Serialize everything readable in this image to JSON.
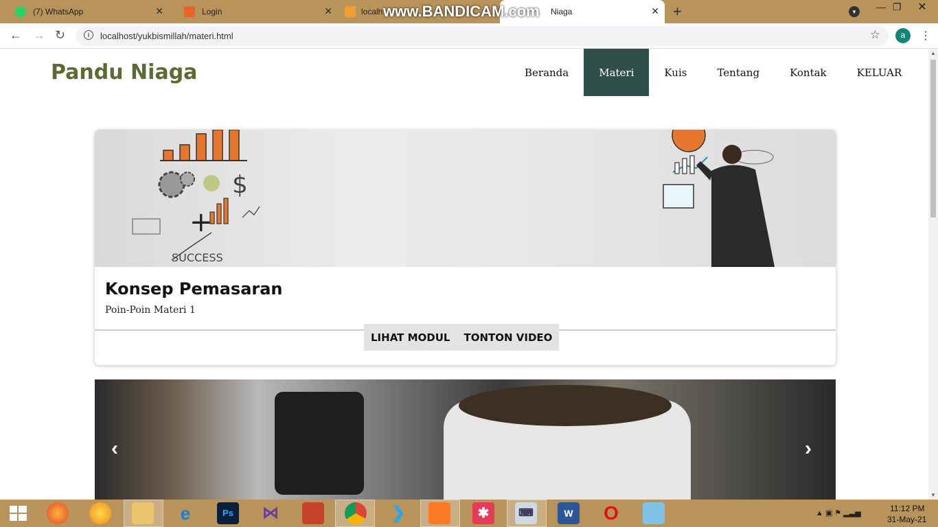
{
  "browser": {
    "tabs": [
      {
        "label": "(7) WhatsApp",
        "icon": "whatsapp-icon"
      },
      {
        "label": "Login",
        "icon": "xampp-icon"
      },
      {
        "label": "localh",
        "icon": "pma-icon"
      },
      {
        "label": "Niaga",
        "icon": "page-icon"
      }
    ],
    "watermark": "www.BANDICAM.com",
    "url": "localhost/yukbismillah/materi.html",
    "avatar_letter": "a"
  },
  "site": {
    "brand": "Pandu Niaga",
    "nav": [
      "Beranda",
      "Materi",
      "Kuis",
      "Tentang",
      "Kontak",
      "KELUAR"
    ],
    "active_nav": "Materi"
  },
  "card": {
    "title": "Konsep Pemasaran",
    "subtitle": "Poin-Poin Materi 1",
    "buttons": [
      "LIHAT MODUL",
      "TONTON VIDEO"
    ]
  },
  "carousel": {
    "prev_icon": "chevron-left-icon",
    "next_icon": "chevron-right-icon"
  },
  "taskbar": {
    "time": "11:12 PM",
    "date": "31-May-21"
  },
  "colors": {
    "brand": "#5b6b33",
    "nav_active": "#2f4f4a",
    "chrome": "#b8935a"
  }
}
